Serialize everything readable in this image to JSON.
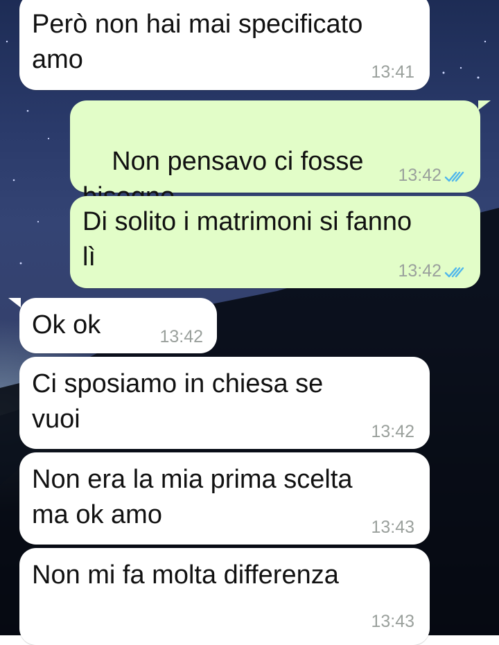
{
  "messages": [
    {
      "id": "m1",
      "direction": "incoming",
      "text": "Però non hai mai specificato\namo",
      "time": "13:41"
    },
    {
      "id": "m2",
      "direction": "outgoing",
      "text": "Non pensavo ci fosse\nbisogno",
      "emoji": "smiling-face-emoji",
      "time": "13:42",
      "status": "read"
    },
    {
      "id": "m3",
      "direction": "outgoing",
      "text": "Di solito i matrimoni si fanno\nlì",
      "time": "13:42",
      "status": "read"
    },
    {
      "id": "m4",
      "direction": "incoming",
      "text": "Ok ok",
      "time": "13:42"
    },
    {
      "id": "m5",
      "direction": "incoming",
      "text": "Ci sposiamo in chiesa se\nvuoi",
      "time": "13:42"
    },
    {
      "id": "m6",
      "direction": "incoming",
      "text": "Non era la mia prima scelta\nma ok amo",
      "time": "13:43"
    },
    {
      "id": "m7",
      "direction": "incoming",
      "text": "Non mi fa molta differenza",
      "time": "13:43"
    }
  ],
  "colors": {
    "incoming_bubble": "#ffffff",
    "outgoing_bubble": "#e2fdc8",
    "read_ticks": "#4fb6ec",
    "timestamp": "#9aa09c"
  },
  "icons": {
    "read_receipt": "double-check-icon",
    "emoji": "smiling-face-emoji"
  }
}
